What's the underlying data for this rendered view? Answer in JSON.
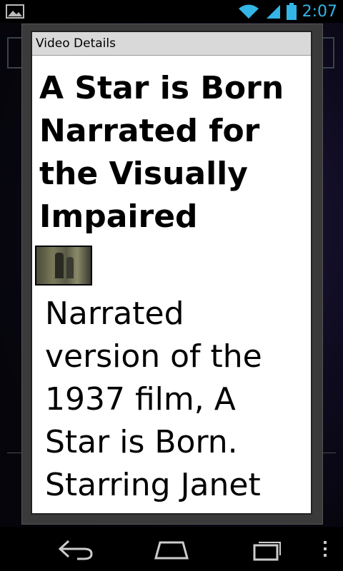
{
  "status_bar": {
    "time": "2:07",
    "icons": [
      "gallery-icon",
      "wifi-icon",
      "signal-icon",
      "battery-icon"
    ],
    "accent_color": "#33b5e5"
  },
  "dialog": {
    "title": "Video Details",
    "video_title": "A Star is Born Narrated for the Visually Impaired",
    "description": "Narrated version of the 1937 film, A Star is Born. Starring Janet"
  },
  "nav_bar": {
    "icons": [
      "back-icon",
      "home-icon",
      "recent-apps-icon",
      "menu-icon"
    ]
  }
}
